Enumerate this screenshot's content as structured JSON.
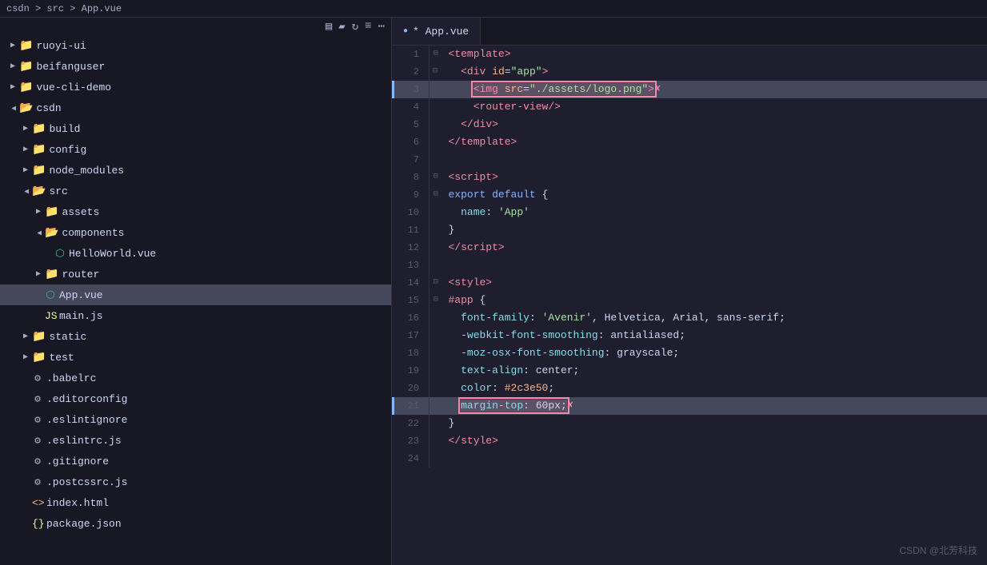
{
  "topbar": {
    "breadcrumb": "csdn > src > App.vue"
  },
  "tab": {
    "label": "* App.vue",
    "active": true
  },
  "sidebar": {
    "toolbar": {
      "icons": [
        "new-file",
        "new-folder",
        "refresh",
        "collapse"
      ]
    },
    "tree": [
      {
        "id": 1,
        "indent": 0,
        "type": "folder",
        "open": false,
        "label": "ruoyi-ui"
      },
      {
        "id": 2,
        "indent": 0,
        "type": "folder",
        "open": false,
        "label": "beifanguser"
      },
      {
        "id": 3,
        "indent": 0,
        "type": "folder",
        "open": false,
        "label": "vue-cli-demo"
      },
      {
        "id": 4,
        "indent": 0,
        "type": "folder",
        "open": true,
        "label": "csdn"
      },
      {
        "id": 5,
        "indent": 1,
        "type": "folder",
        "open": false,
        "label": "build"
      },
      {
        "id": 6,
        "indent": 1,
        "type": "folder",
        "open": false,
        "label": "config"
      },
      {
        "id": 7,
        "indent": 1,
        "type": "folder",
        "open": false,
        "label": "node_modules"
      },
      {
        "id": 8,
        "indent": 1,
        "type": "folder",
        "open": true,
        "label": "src"
      },
      {
        "id": 9,
        "indent": 2,
        "type": "folder",
        "open": false,
        "label": "assets"
      },
      {
        "id": 10,
        "indent": 2,
        "type": "folder",
        "open": true,
        "label": "components"
      },
      {
        "id": 11,
        "indent": 3,
        "type": "file",
        "label": "HelloWorld.vue",
        "fileType": "vue"
      },
      {
        "id": 12,
        "indent": 2,
        "type": "folder",
        "open": false,
        "label": "router"
      },
      {
        "id": 13,
        "indent": 2,
        "type": "file",
        "label": "App.vue",
        "fileType": "vue",
        "selected": true
      },
      {
        "id": 14,
        "indent": 2,
        "type": "file",
        "label": "main.js",
        "fileType": "js"
      },
      {
        "id": 15,
        "indent": 1,
        "type": "folder",
        "open": false,
        "label": "static"
      },
      {
        "id": 16,
        "indent": 1,
        "type": "folder",
        "open": false,
        "label": "test"
      },
      {
        "id": 17,
        "indent": 1,
        "type": "file",
        "label": ".babelrc",
        "fileType": "config"
      },
      {
        "id": 18,
        "indent": 1,
        "type": "file",
        "label": ".editorconfig",
        "fileType": "config"
      },
      {
        "id": 19,
        "indent": 1,
        "type": "file",
        "label": ".eslintignore",
        "fileType": "config"
      },
      {
        "id": 20,
        "indent": 1,
        "type": "file",
        "label": ".eslintrc.js",
        "fileType": "config"
      },
      {
        "id": 21,
        "indent": 1,
        "type": "file",
        "label": ".gitignore",
        "fileType": "config"
      },
      {
        "id": 22,
        "indent": 1,
        "type": "file",
        "label": ".postcssrc.js",
        "fileType": "config"
      },
      {
        "id": 23,
        "indent": 1,
        "type": "file",
        "label": "index.html",
        "fileType": "html"
      },
      {
        "id": 24,
        "indent": 1,
        "type": "file",
        "label": "package.json",
        "fileType": "json"
      }
    ]
  },
  "watermark": "CSDN @北芳科技"
}
